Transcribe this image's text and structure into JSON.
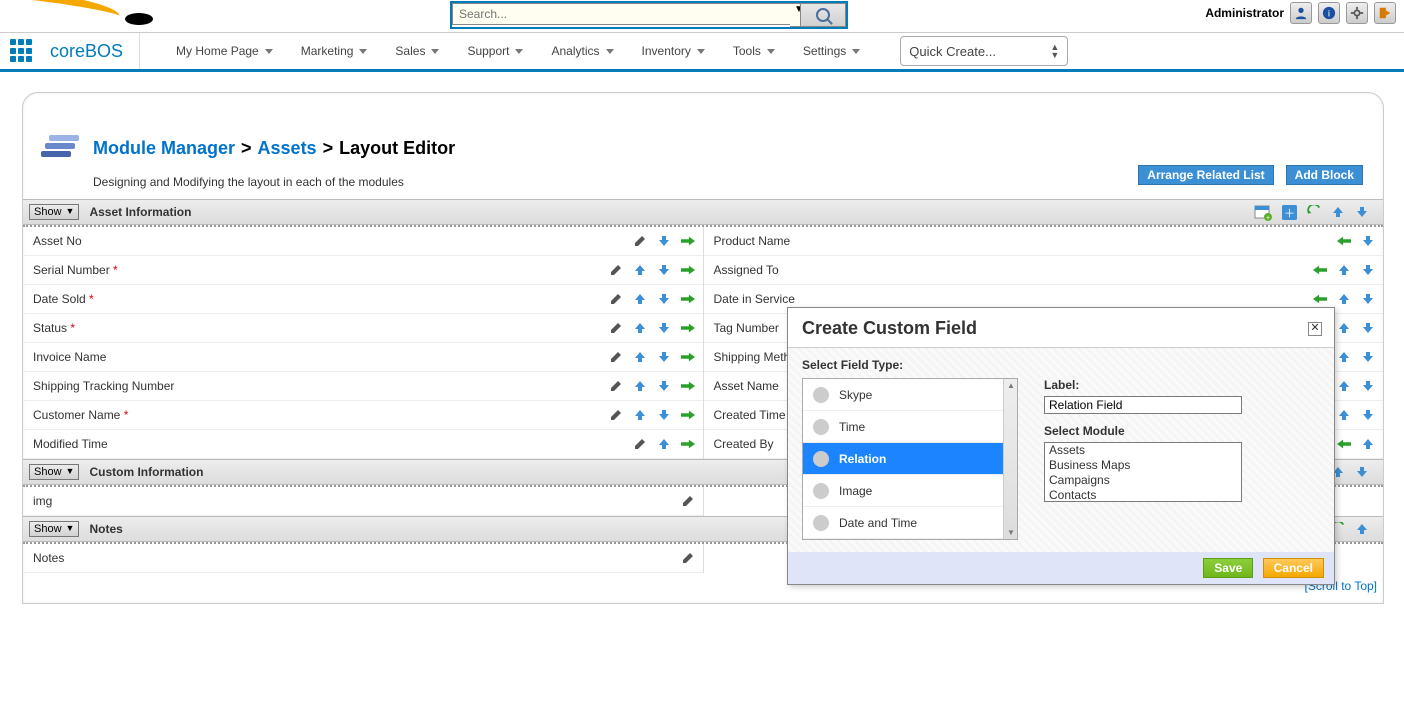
{
  "topbar": {
    "search_placeholder": "Search...",
    "admin_label": "Administrator"
  },
  "nav": {
    "brand": "coreBOS",
    "items": [
      "My Home Page",
      "Marketing",
      "Sales",
      "Support",
      "Analytics",
      "Inventory",
      "Tools",
      "Settings"
    ],
    "quick_create": "Quick Create..."
  },
  "breadcrumb": {
    "module_manager": "Module Manager",
    "assets": "Assets",
    "layout_editor": "Layout Editor",
    "sub": "Designing and Modifying the layout in each of the modules"
  },
  "panel_buttons": {
    "arrange": "Arrange Related List",
    "addblock": "Add Block"
  },
  "blocks": [
    {
      "title": "Asset Information",
      "show_label": "Show",
      "left": [
        {
          "label": "Asset No",
          "req": false,
          "icons": [
            "edit",
            "down",
            "right"
          ]
        },
        {
          "label": "Serial Number",
          "req": true,
          "icons": [
            "edit",
            "up",
            "down",
            "right"
          ]
        },
        {
          "label": "Date Sold",
          "req": true,
          "icons": [
            "edit",
            "up",
            "down",
            "right"
          ]
        },
        {
          "label": "Status",
          "req": true,
          "icons": [
            "edit",
            "up",
            "down",
            "right"
          ]
        },
        {
          "label": "Invoice Name",
          "req": false,
          "icons": [
            "edit",
            "up",
            "down",
            "right"
          ]
        },
        {
          "label": "Shipping Tracking Number",
          "req": false,
          "icons": [
            "edit",
            "up",
            "down",
            "right"
          ]
        },
        {
          "label": "Customer Name",
          "req": true,
          "icons": [
            "edit",
            "up",
            "down",
            "right"
          ]
        },
        {
          "label": "Modified Time",
          "req": false,
          "icons": [
            "edit",
            "up",
            "right"
          ]
        }
      ],
      "right": [
        {
          "label": "Product Name",
          "req": false,
          "icons": [
            "left",
            "down"
          ]
        },
        {
          "label": "Assigned To",
          "req": false,
          "icons": [
            "left",
            "up",
            "down"
          ]
        },
        {
          "label": "Date in Service",
          "req": false,
          "icons": [
            "left",
            "up",
            "down"
          ]
        },
        {
          "label": "Tag Number",
          "req": false,
          "icons": [
            "left",
            "up",
            "down"
          ]
        },
        {
          "label": "Shipping Method",
          "req": false,
          "icons": [
            "left",
            "up",
            "down"
          ]
        },
        {
          "label": "Asset Name",
          "req": false,
          "icons": [
            "left",
            "up",
            "down"
          ]
        },
        {
          "label": "Created Time",
          "req": false,
          "icons": [
            "left",
            "up",
            "down"
          ]
        },
        {
          "label": "Created By",
          "req": false,
          "icons": [
            "left",
            "up"
          ]
        }
      ],
      "tools": [
        "addcf",
        "plus",
        "unhide",
        "up",
        "down"
      ]
    },
    {
      "title": "Custom Information",
      "show_label": "Show",
      "left": [
        {
          "label": "img",
          "req": false,
          "icons": [
            "edit"
          ]
        }
      ],
      "right": [],
      "tools": [
        "addcf",
        "plus",
        "unhide",
        "up",
        "down"
      ]
    },
    {
      "title": "Notes",
      "show_label": "Show",
      "left": [
        {
          "label": "Notes",
          "req": false,
          "icons": [
            "edit"
          ]
        }
      ],
      "right": [],
      "tools": [
        "addcf",
        "plus",
        "unhide",
        "up"
      ]
    }
  ],
  "scroll_to_top": "[Scroll to Top]",
  "popup": {
    "title": "Create Custom Field",
    "select_ft": "Select Field Type:",
    "types": [
      {
        "name": "Skype"
      },
      {
        "name": "Time"
      },
      {
        "name": "Relation",
        "selected": true
      },
      {
        "name": "Image"
      },
      {
        "name": "Date and Time"
      }
    ],
    "label_lbl": "Label:",
    "label_value": "Relation Field",
    "module_lbl": "Select Module",
    "modules": [
      "Assets",
      "Business Maps",
      "Campaigns",
      "Contacts"
    ],
    "save": "Save",
    "cancel": "Cancel"
  }
}
